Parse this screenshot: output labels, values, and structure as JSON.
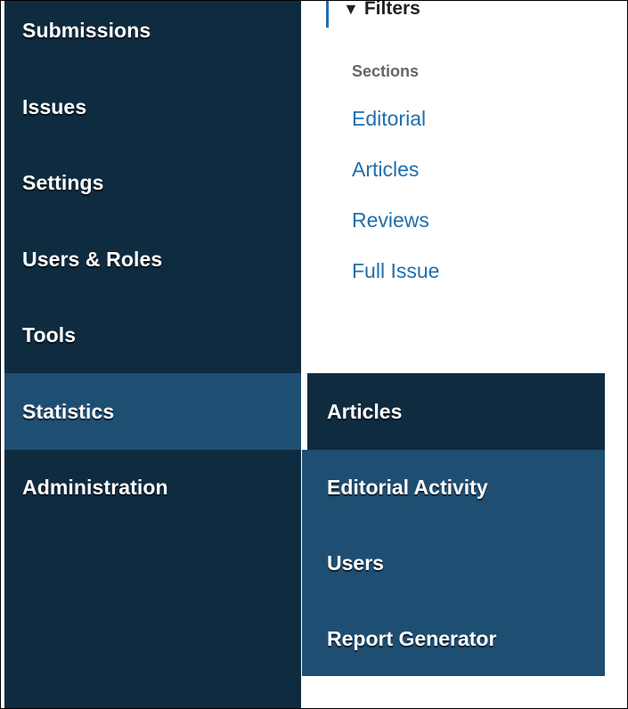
{
  "sidebar": {
    "items": [
      {
        "label": "Submissions"
      },
      {
        "label": "Issues"
      },
      {
        "label": "Settings"
      },
      {
        "label": "Users & Roles"
      },
      {
        "label": "Tools"
      },
      {
        "label": "Statistics",
        "active": true
      },
      {
        "label": "Administration"
      }
    ]
  },
  "main": {
    "filters_heading": "Filters",
    "filter_icon": "funnel-icon",
    "sections_label": "Sections",
    "sections": [
      {
        "label": "Editorial"
      },
      {
        "label": "Articles"
      },
      {
        "label": "Reviews"
      },
      {
        "label": "Full Issue"
      }
    ]
  },
  "submenu": {
    "items": [
      {
        "label": "Articles",
        "current": true
      },
      {
        "label": "Editorial Activity"
      },
      {
        "label": "Users"
      },
      {
        "label": "Report Generator"
      }
    ]
  },
  "colors": {
    "sidebar_bg": "#0f2b40",
    "active_bg": "#1f4e73",
    "link": "#1f6fae",
    "muted_label": "#666666"
  }
}
